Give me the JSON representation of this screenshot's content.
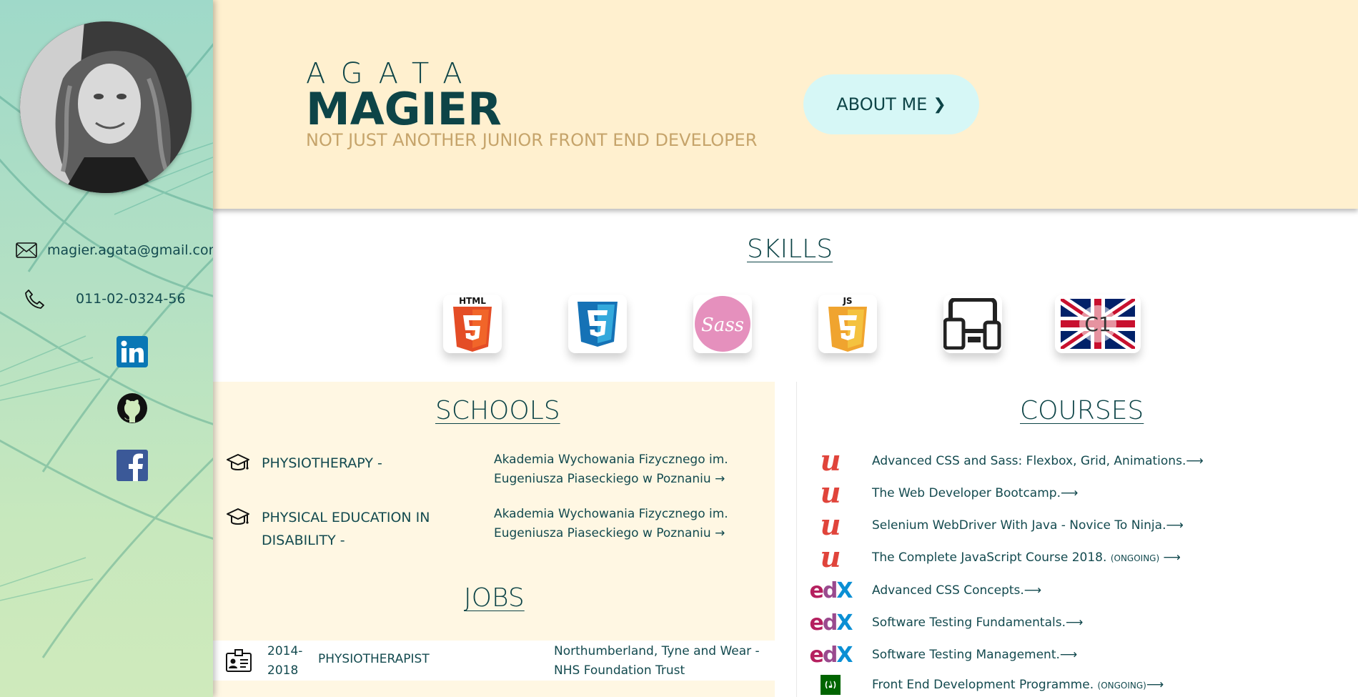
{
  "profile": {
    "first_name": "AGATA",
    "last_name": "MAGIER",
    "tagline": "NOT JUST ANOTHER JUNIOR FRONT END DEVELOPER",
    "about_label": "ABOUT ME",
    "about_chevron": "❯"
  },
  "contact": {
    "email": "magier.agata@gmail.com",
    "phone": "011-02-0324-56",
    "email_icon": "envelope-icon",
    "phone_icon": "phone-icon"
  },
  "social": [
    "linkedin-icon",
    "github-icon",
    "facebook-icon"
  ],
  "sections": {
    "skills": "SKILLS",
    "schools": "SCHOOLS",
    "jobs": "JOBS",
    "courses": "COURSES"
  },
  "skills": [
    {
      "name": "html5-icon",
      "label": "HTML"
    },
    {
      "name": "css3-icon",
      "label": ""
    },
    {
      "name": "sass-icon",
      "label": "Sass"
    },
    {
      "name": "javascript-icon",
      "label": "JS"
    },
    {
      "name": "responsive-devices-icon",
      "label": ""
    },
    {
      "name": "english-c1-icon",
      "label": "C1"
    }
  ],
  "schools": [
    {
      "title": "PHYSIOTHERAPY -",
      "place_line1": "Akademia Wychowania Fizycznego im.",
      "place_line2": "Eugeniusza Piaseckiego w Poznaniu →"
    },
    {
      "title": "PHYSICAL EDUCATION IN DISABILITY -",
      "place_line1": "Akademia Wychowania Fizycznego im.",
      "place_line2": "Eugeniusza Piaseckiego w Poznaniu →"
    }
  ],
  "jobs": [
    {
      "year_line1": "2014-",
      "year_line2": "2018",
      "title": "PHYSIOTHERAPIST",
      "place_line1": "Northumberland, Tyne and Wear -",
      "place_line2": "NHS Foundation Trust"
    }
  ],
  "courses": [
    {
      "provider": "udemy",
      "text": "Advanced CSS and Sass: Flexbox, Grid, Animations.⟶",
      "ongoing": "",
      "suffix": ""
    },
    {
      "provider": "udemy",
      "text": "The Web Developer Bootcamp.⟶",
      "ongoing": "",
      "suffix": ""
    },
    {
      "provider": "udemy",
      "text": "Selenium WebDriver With Java - Novice To Ninja.⟶",
      "ongoing": "",
      "suffix": ""
    },
    {
      "provider": "udemy",
      "text": "The Complete JavaScript Course 2018.",
      "ongoing": "(ONGOING)",
      "suffix": " ⟶"
    },
    {
      "provider": "edx",
      "text": "Advanced CSS Concepts.⟶",
      "ongoing": "",
      "suffix": ""
    },
    {
      "provider": "edx",
      "text": "Software Testing Fundamentals.⟶",
      "ongoing": "",
      "suffix": ""
    },
    {
      "provider": "edx",
      "text": "Software Testing Management.⟶",
      "ongoing": "",
      "suffix": ""
    },
    {
      "provider": "freecodecamp",
      "text": "Front End Development Programme.",
      "ongoing": "(ONGOING)",
      "suffix": "⟶"
    }
  ],
  "colors": {
    "header_bg": "#fff0cf",
    "accent_text": "#0d4447",
    "tagline": "#c6a46b",
    "about_button": "#d6f7f6",
    "panel_bg": "#fff7e3"
  }
}
